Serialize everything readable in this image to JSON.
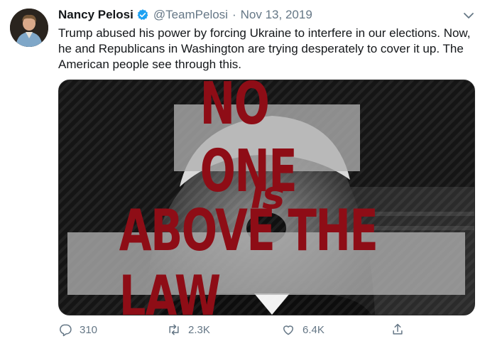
{
  "tweet": {
    "author_name": "Nancy Pelosi",
    "handle": "@TeamPelosi",
    "separator": "·",
    "date": "Nov 13, 2019",
    "verified": true,
    "text": "Trump abused his power by forcing Ukraine to interfere in our elections. Now, he and Republicans in Washington are trying desperately to cover it up. The American people see through this."
  },
  "media": {
    "line1": "NO ONE",
    "line2": "is",
    "line3": "ABOVE THE LAW",
    "text_color": "#8e0d16"
  },
  "actions": {
    "replies": "310",
    "retweets": "2.3K",
    "likes": "6.4K"
  },
  "colors": {
    "verified": "#1da1f2",
    "muted": "#657786",
    "text": "#14171a"
  },
  "icons": [
    "verified-badge-icon",
    "chevron-down-icon",
    "reply-icon",
    "retweet-icon",
    "like-icon",
    "share-icon"
  ]
}
